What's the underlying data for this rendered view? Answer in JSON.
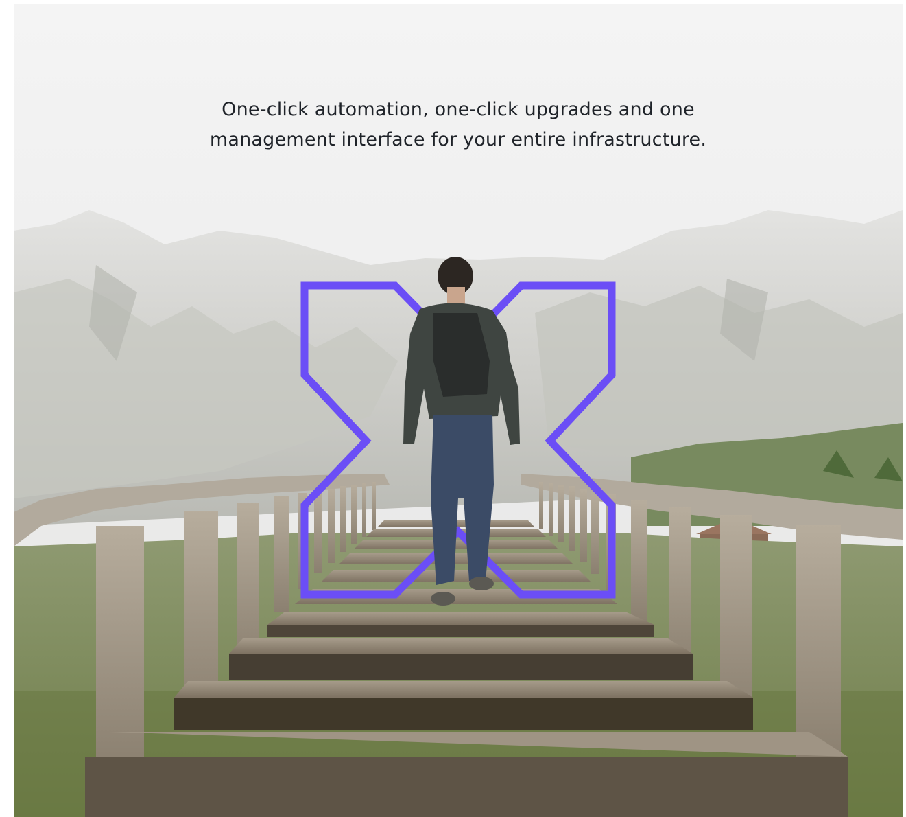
{
  "hero": {
    "tagline_line1": "One-click automation, one-click upgrades and one",
    "tagline_line2": "management interface for your entire infrastructure.",
    "brand_color": "#6b4ef6"
  }
}
